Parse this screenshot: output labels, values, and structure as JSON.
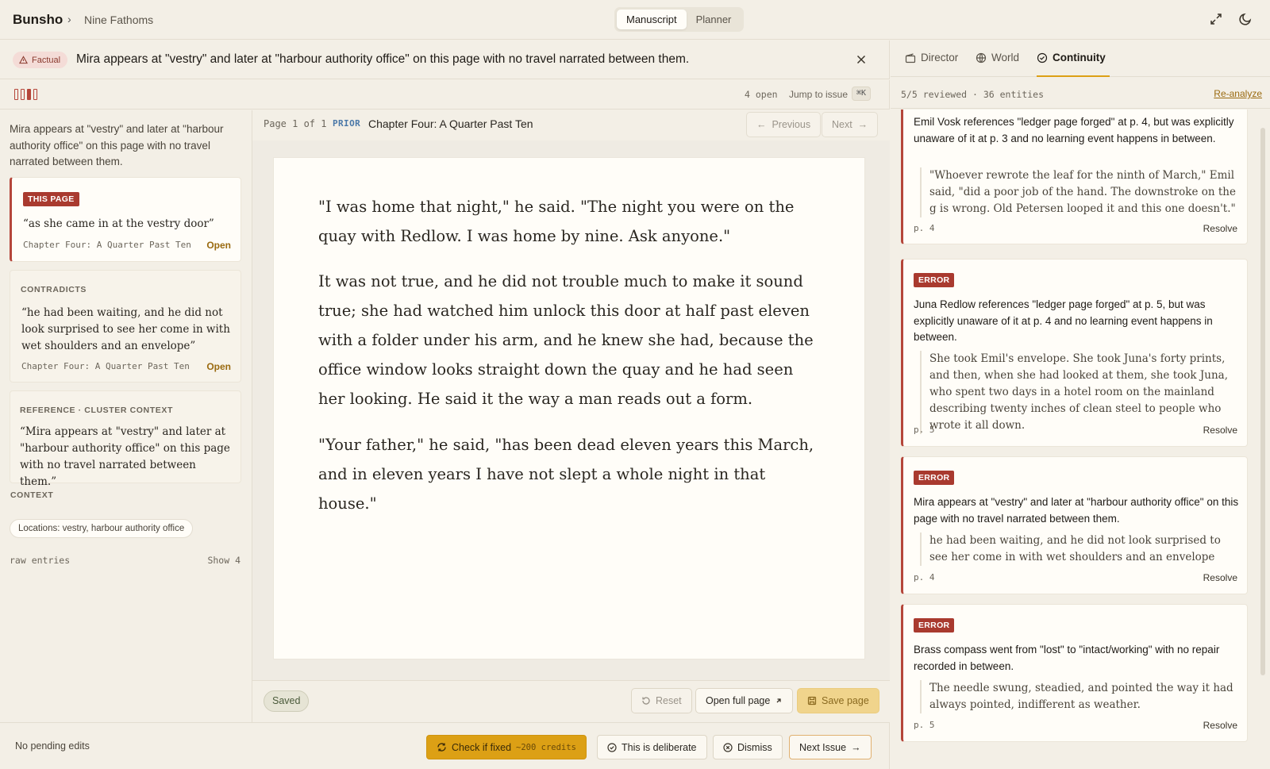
{
  "app": {
    "brand": "Bunsho",
    "crumb_sep": "›",
    "project": "Nine Fathoms"
  },
  "mode_tabs": [
    {
      "label": "Manuscript",
      "active": true
    },
    {
      "label": "Planner",
      "active": false
    }
  ],
  "banner": {
    "category": "Factual",
    "message": "Mira appears at \"vestry\" and later at \"harbour authority office\" on this page with no travel narrated between them."
  },
  "toolbar": {
    "open_count": "4 open",
    "jump_label": "Jump to issue",
    "jump_kbd": "⌘K"
  },
  "left": {
    "lead": "Mira appears at \"vestry\" and later at \"harbour authority office\" on this page with no travel narrated between them.",
    "this_page": {
      "badge": "THIS PAGE",
      "quote": "“as she came in at the vestry door”",
      "chapter": "Chapter Four: A Quarter Past Ten",
      "open": "Open"
    },
    "contradicts": {
      "label": "CONTRADICTS",
      "quote": "“he had been waiting, and he did not look surprised to see her come in with wet shoulders and an envelope”",
      "chapter": "Chapter Four: A Quarter Past Ten",
      "open": "Open"
    },
    "reference": {
      "label": "REFERENCE · CLUSTER CONTEXT",
      "quote": "“Mira appears at \"vestry\" and later at \"harbour authority office\" on this page with no travel narrated between them.”"
    },
    "context_label": "CONTEXT",
    "context_chip": "Locations: vestry, harbour authority office",
    "raw_entries": "raw entries",
    "show_raw": "Show 4"
  },
  "editor": {
    "page_indicator": "Page 1 of 1",
    "prior": "PRIOR",
    "chapter_title": "Chapter Four: A Quarter Past Ten",
    "previous": "Previous",
    "next": "Next",
    "paragraphs": [
      "\"I was home that night,\" he said. \"The night you were on the quay with Redlow. I was home by nine. Ask anyone.\"",
      "It was not true, and he did not trouble much to make it sound true; she had watched him unlock this door at half past eleven with a folder under his arm, and he knew she had, because the office window looks straight down the quay and he had seen her looking. He said it the way a man reads out a form.",
      "\"Your father,\" he said, \"has been dead eleven years this March, and in eleven years I have not slept a whole night in that house.\""
    ],
    "saved": "Saved",
    "reset": "Reset",
    "open_full": "Open full page",
    "save_page": "Save page"
  },
  "actions": {
    "pending": "No pending edits",
    "check_fixed": "Check if fixed",
    "credits": "~200 credits",
    "deliberate": "This is deliberate",
    "dismiss": "Dismiss",
    "next_issue": "Next Issue"
  },
  "right": {
    "tabs": [
      {
        "label": "Director"
      },
      {
        "label": "World"
      },
      {
        "label": "Continuity",
        "active": true
      }
    ],
    "reviewed": "5/5 reviewed · 36 entities",
    "reanalyze": "Re-analyze",
    "issues": [
      {
        "badge": "",
        "title": "Emil Vosk references \"ledger page forged\" at p. 4, but was explicitly unaware of it at p. 3 and no learning event happens in between.",
        "quote": "\"Whoever rewrote the leaf for the ninth of March,\" Emil said, \"did a poor job of the hand. The downstroke on the g is wrong. Old Petersen looped it and this one doesn't.\"",
        "page": "p. 4",
        "resolve": "Resolve"
      },
      {
        "badge": "ERROR",
        "title": "Juna Redlow references \"ledger page forged\" at p. 5, but was explicitly unaware of it at p. 4 and no learning event happens in between.",
        "quote": "She took Emil's envelope. She took Juna's forty prints, and then, when she had looked at them, she took Juna, who spent two days in a hotel room on the mainland describing twenty inches of clean steel to people who wrote it all down.",
        "page": "p. 5",
        "resolve": "Resolve"
      },
      {
        "badge": "ERROR",
        "title": "Mira appears at \"vestry\" and later at \"harbour authority office\" on this page with no travel narrated between them.",
        "quote": "he had been waiting, and he did not look surprised to see her come in with wet shoulders and an envelope",
        "page": "p. 4",
        "resolve": "Resolve"
      },
      {
        "badge": "ERROR",
        "title": "Brass compass went from \"lost\" to \"intact/working\" with no repair recorded in between.",
        "quote": "The needle swung, steadied, and pointed the way it had always pointed, indifferent as weather.",
        "page": "p. 5",
        "resolve": "Resolve"
      }
    ]
  }
}
